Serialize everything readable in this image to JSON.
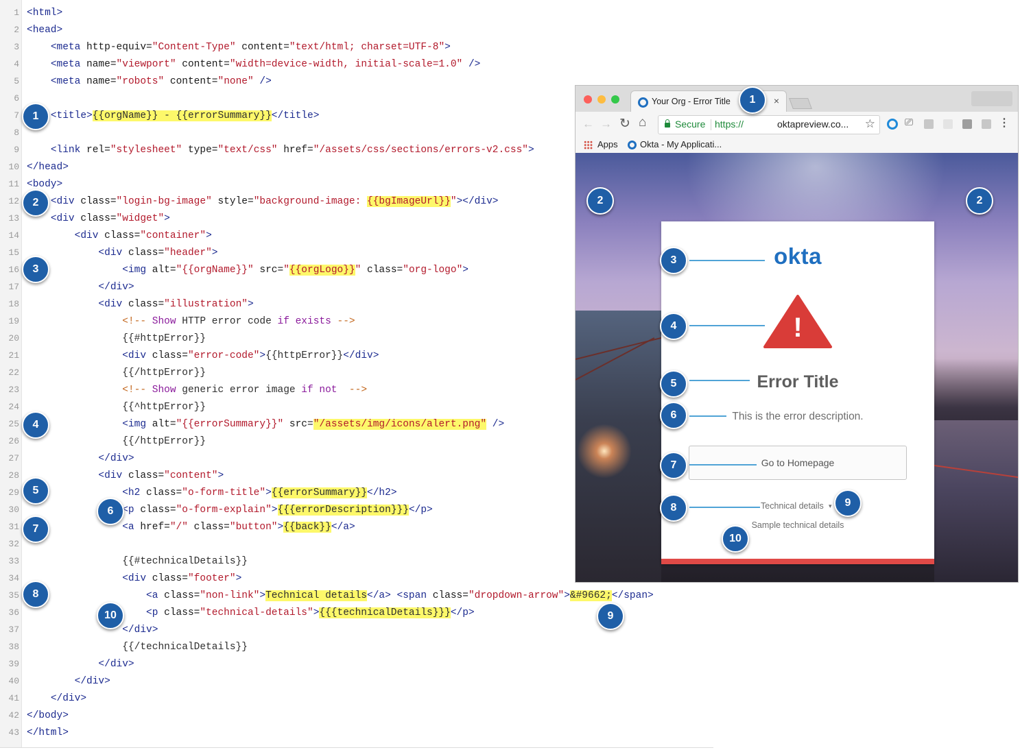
{
  "code": {
    "lines": [
      {
        "n": "1",
        "tokens": [
          {
            "t": "<html>",
            "c": "tag"
          }
        ]
      },
      {
        "n": "2",
        "tokens": [
          {
            "t": "<head>",
            "c": "tag"
          }
        ]
      },
      {
        "n": "3",
        "tokens": [
          {
            "t": "    "
          },
          {
            "t": "<meta ",
            "c": "tag"
          },
          {
            "t": "http-equiv=",
            "c": "attr"
          },
          {
            "t": "\"Content-Type\"",
            "c": "str"
          },
          {
            "t": " content=",
            "c": "attr"
          },
          {
            "t": "\"text/html; charset=UTF-8\"",
            "c": "str"
          },
          {
            "t": ">",
            "c": "tag"
          }
        ]
      },
      {
        "n": "4",
        "tokens": [
          {
            "t": "    "
          },
          {
            "t": "<meta ",
            "c": "tag"
          },
          {
            "t": "name=",
            "c": "attr"
          },
          {
            "t": "\"viewport\"",
            "c": "str"
          },
          {
            "t": " content=",
            "c": "attr"
          },
          {
            "t": "\"width=device-width, initial-scale=1.0\"",
            "c": "str"
          },
          {
            "t": " />",
            "c": "tag"
          }
        ]
      },
      {
        "n": "5",
        "tokens": [
          {
            "t": "    "
          },
          {
            "t": "<meta ",
            "c": "tag"
          },
          {
            "t": "name=",
            "c": "attr"
          },
          {
            "t": "\"robots\"",
            "c": "str"
          },
          {
            "t": " content=",
            "c": "attr"
          },
          {
            "t": "\"none\"",
            "c": "str"
          },
          {
            "t": " />",
            "c": "tag"
          }
        ]
      },
      {
        "n": "6",
        "tokens": []
      },
      {
        "n": "7",
        "tokens": [
          {
            "t": "    "
          },
          {
            "t": "<title>",
            "c": "tag"
          },
          {
            "t": "{{orgName}} - {{errorSummary}}",
            "c": "txt",
            "hl": true
          },
          {
            "t": "</title>",
            "c": "tag"
          }
        ]
      },
      {
        "n": "8",
        "tokens": []
      },
      {
        "n": "9",
        "tokens": [
          {
            "t": "    "
          },
          {
            "t": "<link ",
            "c": "tag"
          },
          {
            "t": "rel=",
            "c": "attr"
          },
          {
            "t": "\"stylesheet\"",
            "c": "str"
          },
          {
            "t": " type=",
            "c": "attr"
          },
          {
            "t": "\"text/css\"",
            "c": "str"
          },
          {
            "t": " href=",
            "c": "attr"
          },
          {
            "t": "\"/assets/css/sections/errors-v2.css\"",
            "c": "str"
          },
          {
            "t": ">",
            "c": "tag"
          }
        ]
      },
      {
        "n": "10",
        "tokens": [
          {
            "t": "</head>",
            "c": "tag"
          }
        ]
      },
      {
        "n": "11",
        "tokens": [
          {
            "t": "<body>",
            "c": "tag"
          }
        ]
      },
      {
        "n": "12",
        "tokens": [
          {
            "t": "    "
          },
          {
            "t": "<div ",
            "c": "tag"
          },
          {
            "t": "class=",
            "c": "attr"
          },
          {
            "t": "\"login-bg-image\"",
            "c": "str"
          },
          {
            "t": " style=",
            "c": "attr"
          },
          {
            "t": "\"background-image: ",
            "c": "str"
          },
          {
            "t": "{{bgImageUrl}}",
            "c": "str",
            "hl": true
          },
          {
            "t": "\"",
            "c": "str"
          },
          {
            "t": "></div>",
            "c": "tag"
          }
        ]
      },
      {
        "n": "13",
        "tokens": [
          {
            "t": "    "
          },
          {
            "t": "<div ",
            "c": "tag"
          },
          {
            "t": "class=",
            "c": "attr"
          },
          {
            "t": "\"widget\"",
            "c": "str"
          },
          {
            "t": ">",
            "c": "tag"
          }
        ]
      },
      {
        "n": "14",
        "tokens": [
          {
            "t": "        "
          },
          {
            "t": "<div ",
            "c": "tag"
          },
          {
            "t": "class=",
            "c": "attr"
          },
          {
            "t": "\"container\"",
            "c": "str"
          },
          {
            "t": ">",
            "c": "tag"
          }
        ]
      },
      {
        "n": "15",
        "tokens": [
          {
            "t": "            "
          },
          {
            "t": "<div ",
            "c": "tag"
          },
          {
            "t": "class=",
            "c": "attr"
          },
          {
            "t": "\"header\"",
            "c": "str"
          },
          {
            "t": ">",
            "c": "tag"
          }
        ]
      },
      {
        "n": "16",
        "tokens": [
          {
            "t": "                "
          },
          {
            "t": "<img ",
            "c": "tag"
          },
          {
            "t": "alt=",
            "c": "attr"
          },
          {
            "t": "\"{{orgName}}\"",
            "c": "str"
          },
          {
            "t": " src=",
            "c": "attr"
          },
          {
            "t": "\"",
            "c": "str"
          },
          {
            "t": "{{orgLogo}}",
            "c": "str",
            "hl": true
          },
          {
            "t": "\"",
            "c": "str"
          },
          {
            "t": " class=",
            "c": "attr"
          },
          {
            "t": "\"org-logo\"",
            "c": "str"
          },
          {
            "t": ">",
            "c": "tag"
          }
        ]
      },
      {
        "n": "17",
        "tokens": [
          {
            "t": "            "
          },
          {
            "t": "</div>",
            "c": "tag"
          }
        ]
      },
      {
        "n": "18",
        "tokens": [
          {
            "t": "            "
          },
          {
            "t": "<div ",
            "c": "tag"
          },
          {
            "t": "class=",
            "c": "attr"
          },
          {
            "t": "\"illustration\"",
            "c": "str"
          },
          {
            "t": ">",
            "c": "tag"
          }
        ]
      },
      {
        "n": "19",
        "tokens": [
          {
            "t": "                "
          },
          {
            "t": "<!-- ",
            "c": "com"
          },
          {
            "t": "Show",
            "c": "kw"
          },
          {
            "t": " HTTP error code ",
            "c": "txt"
          },
          {
            "t": "if exists",
            "c": "kw"
          },
          {
            "t": " -->",
            "c": "com"
          }
        ]
      },
      {
        "n": "20",
        "tokens": [
          {
            "t": "                "
          },
          {
            "t": "{{#httpError}}",
            "c": "txt"
          }
        ]
      },
      {
        "n": "21",
        "tokens": [
          {
            "t": "                "
          },
          {
            "t": "<div ",
            "c": "tag"
          },
          {
            "t": "class=",
            "c": "attr"
          },
          {
            "t": "\"error-code\"",
            "c": "str"
          },
          {
            "t": ">",
            "c": "tag"
          },
          {
            "t": "{{httpError}}",
            "c": "txt"
          },
          {
            "t": "</div>",
            "c": "tag"
          }
        ]
      },
      {
        "n": "22",
        "tokens": [
          {
            "t": "                "
          },
          {
            "t": "{{/httpError}}",
            "c": "txt"
          }
        ]
      },
      {
        "n": "23",
        "tokens": [
          {
            "t": "                "
          },
          {
            "t": "<!-- ",
            "c": "com"
          },
          {
            "t": "Show",
            "c": "kw"
          },
          {
            "t": " generic error image ",
            "c": "txt"
          },
          {
            "t": "if not",
            "c": "kw"
          },
          {
            "t": "  -->",
            "c": "com"
          }
        ]
      },
      {
        "n": "24",
        "tokens": [
          {
            "t": "                "
          },
          {
            "t": "{{^httpError}}",
            "c": "txt"
          }
        ]
      },
      {
        "n": "25",
        "tokens": [
          {
            "t": "                "
          },
          {
            "t": "<img ",
            "c": "tag"
          },
          {
            "t": "alt=",
            "c": "attr"
          },
          {
            "t": "\"{{errorSummary}}\"",
            "c": "str"
          },
          {
            "t": " src=",
            "c": "attr"
          },
          {
            "t": "\"/assets/img/icons/alert.png\"",
            "c": "str",
            "hl": true
          },
          {
            "t": " />",
            "c": "tag"
          }
        ]
      },
      {
        "n": "26",
        "tokens": [
          {
            "t": "                "
          },
          {
            "t": "{{/httpError}}",
            "c": "txt"
          }
        ]
      },
      {
        "n": "27",
        "tokens": [
          {
            "t": "            "
          },
          {
            "t": "</div>",
            "c": "tag"
          }
        ]
      },
      {
        "n": "28",
        "tokens": [
          {
            "t": "            "
          },
          {
            "t": "<div ",
            "c": "tag"
          },
          {
            "t": "class=",
            "c": "attr"
          },
          {
            "t": "\"content\"",
            "c": "str"
          },
          {
            "t": ">",
            "c": "tag"
          }
        ]
      },
      {
        "n": "29",
        "tokens": [
          {
            "t": "                "
          },
          {
            "t": "<h2 ",
            "c": "tag"
          },
          {
            "t": "class=",
            "c": "attr"
          },
          {
            "t": "\"o-form-title\"",
            "c": "str"
          },
          {
            "t": ">",
            "c": "tag"
          },
          {
            "t": "{{errorSummary}}",
            "c": "txt",
            "hl": true
          },
          {
            "t": "</h2>",
            "c": "tag"
          }
        ]
      },
      {
        "n": "30",
        "tokens": [
          {
            "t": "                "
          },
          {
            "t": "<p ",
            "c": "tag"
          },
          {
            "t": "class=",
            "c": "attr"
          },
          {
            "t": "\"o-form-explain\"",
            "c": "str"
          },
          {
            "t": ">",
            "c": "tag"
          },
          {
            "t": "{{{errorDescription}}}",
            "c": "txt",
            "hl": true
          },
          {
            "t": "</p>",
            "c": "tag"
          }
        ]
      },
      {
        "n": "31",
        "tokens": [
          {
            "t": "                "
          },
          {
            "t": "<a ",
            "c": "tag"
          },
          {
            "t": "href=",
            "c": "attr"
          },
          {
            "t": "\"/\"",
            "c": "str"
          },
          {
            "t": " class=",
            "c": "attr"
          },
          {
            "t": "\"button\"",
            "c": "str"
          },
          {
            "t": ">",
            "c": "tag"
          },
          {
            "t": "{{back}}",
            "c": "txt",
            "hl": true
          },
          {
            "t": "</a>",
            "c": "tag"
          }
        ]
      },
      {
        "n": "32",
        "tokens": []
      },
      {
        "n": "33",
        "tokens": [
          {
            "t": "                "
          },
          {
            "t": "{{#technicalDetails}}",
            "c": "txt"
          }
        ]
      },
      {
        "n": "34",
        "tokens": [
          {
            "t": "                "
          },
          {
            "t": "<div ",
            "c": "tag"
          },
          {
            "t": "class=",
            "c": "attr"
          },
          {
            "t": "\"footer\"",
            "c": "str"
          },
          {
            "t": ">",
            "c": "tag"
          }
        ]
      },
      {
        "n": "35",
        "tokens": [
          {
            "t": "                    "
          },
          {
            "t": "<a ",
            "c": "tag"
          },
          {
            "t": "class=",
            "c": "attr"
          },
          {
            "t": "\"non-link\"",
            "c": "str"
          },
          {
            "t": ">",
            "c": "tag"
          },
          {
            "t": "Technical details",
            "c": "txt",
            "hl": true
          },
          {
            "t": "</a>",
            "c": "tag"
          },
          {
            "t": " "
          },
          {
            "t": "<span ",
            "c": "tag"
          },
          {
            "t": "class=",
            "c": "attr"
          },
          {
            "t": "\"dropdown-arrow\"",
            "c": "str"
          },
          {
            "t": ">",
            "c": "tag"
          },
          {
            "t": "&#9662;",
            "c": "txt",
            "hl": true
          },
          {
            "t": "</span>",
            "c": "tag"
          }
        ]
      },
      {
        "n": "36",
        "tokens": [
          {
            "t": "                    "
          },
          {
            "t": "<p ",
            "c": "tag"
          },
          {
            "t": "class=",
            "c": "attr"
          },
          {
            "t": "\"technical-details\"",
            "c": "str"
          },
          {
            "t": ">",
            "c": "tag"
          },
          {
            "t": "{{{technicalDetails}}}",
            "c": "txt",
            "hl": true
          },
          {
            "t": "</p>",
            "c": "tag"
          }
        ]
      },
      {
        "n": "37",
        "tokens": [
          {
            "t": "                "
          },
          {
            "t": "</div>",
            "c": "tag"
          }
        ]
      },
      {
        "n": "38",
        "tokens": [
          {
            "t": "                "
          },
          {
            "t": "{{/technicalDetails}}",
            "c": "txt"
          }
        ]
      },
      {
        "n": "39",
        "tokens": [
          {
            "t": "            "
          },
          {
            "t": "</div>",
            "c": "tag"
          }
        ]
      },
      {
        "n": "40",
        "tokens": [
          {
            "t": "        "
          },
          {
            "t": "</div>",
            "c": "tag"
          }
        ]
      },
      {
        "n": "41",
        "tokens": [
          {
            "t": "    "
          },
          {
            "t": "</div>",
            "c": "tag"
          }
        ]
      },
      {
        "n": "42",
        "tokens": [
          {
            "t": "</body>",
            "c": "tag"
          }
        ]
      },
      {
        "n": "43",
        "tokens": [
          {
            "t": "</html>",
            "c": "tag"
          }
        ]
      }
    ]
  },
  "callouts": {
    "c1": "1",
    "c2": "2",
    "c3": "3",
    "c4": "4",
    "c5": "5",
    "c6": "6",
    "c7": "7",
    "c8": "8",
    "c9": "9",
    "c10": "10"
  },
  "browser": {
    "tab_title": "Your Org - Error Title",
    "tab_close": "×",
    "secure_label": "Secure",
    "url_scheme": "https://",
    "url_host": "oktapreview.co...",
    "bookmarks": [
      {
        "label": "Apps",
        "icon": "apps-grid-icon"
      },
      {
        "label": "Okta - My Applicati...",
        "icon": "okta-favicon-icon"
      }
    ]
  },
  "page": {
    "org_logo_text": "okta",
    "alert_icon": "warning-triangle-icon",
    "alert_mark": "!",
    "error_title": "Error Title",
    "error_description": "This is the error description.",
    "home_button": "Go to Homepage",
    "technical_link": "Technical details",
    "dropdown_arrow": "▾",
    "technical_details": "Sample technical details"
  },
  "colors": {
    "badge": "#1f5fa7",
    "highlight": "#fdf86a",
    "okta_blue": "#1f6fc0",
    "alert_red": "#e04a47",
    "secure_green": "#1e8a3a"
  }
}
